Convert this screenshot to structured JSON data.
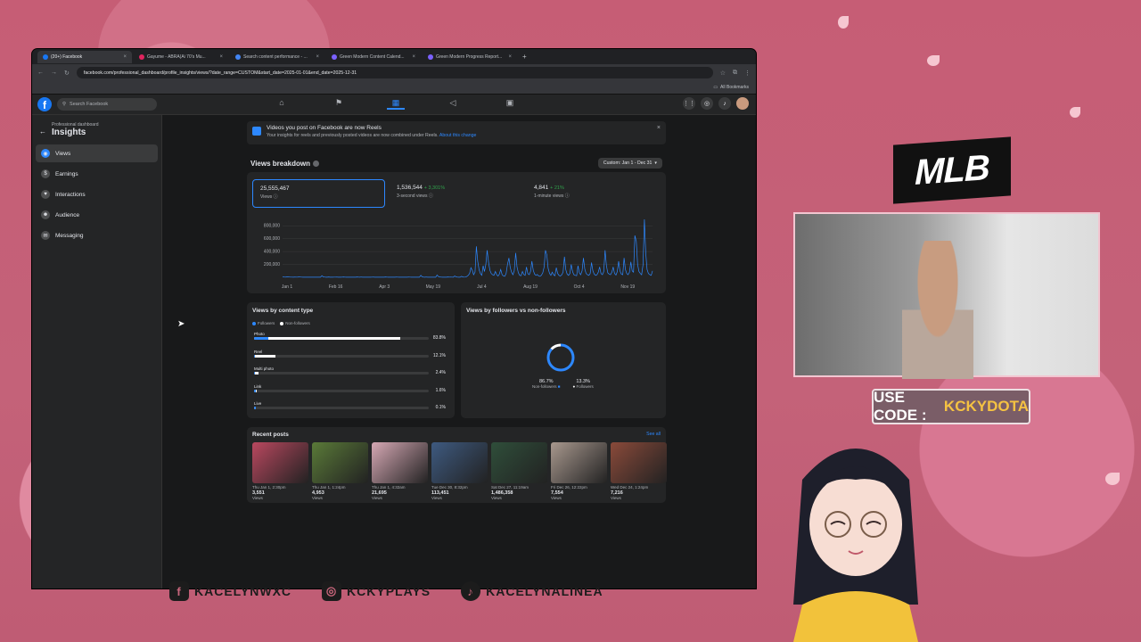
{
  "browser": {
    "tabs": [
      {
        "label": "(20+) Facebook",
        "active": true
      },
      {
        "label": "Gayume - ABRA(Ai 70's Mu...",
        "active": false
      },
      {
        "label": "Search content performance - ...",
        "active": false
      },
      {
        "label": "Green Modern Content Calend...",
        "active": false
      },
      {
        "label": "Green Modern Progress Report...",
        "active": false
      }
    ],
    "url": "facebook.com/professional_dashboard/profile_insights/views/?date_range=CUSTOM&start_date=2025-01-01&end_date=2025-12-31",
    "bookmarks_label": "All Bookmarks"
  },
  "fb": {
    "search_placeholder": "Search Facebook"
  },
  "sidebar": {
    "crumb": "Professional dashboard",
    "title": "Insights",
    "items": [
      {
        "label": "Views",
        "icon": "eye-icon"
      },
      {
        "label": "Earnings",
        "icon": "dollar-icon"
      },
      {
        "label": "Interactions",
        "icon": "heart-icon"
      },
      {
        "label": "Audience",
        "icon": "people-icon"
      },
      {
        "label": "Messaging",
        "icon": "chat-icon"
      }
    ]
  },
  "banner": {
    "title": "Videos you post on Facebook are now Reels",
    "text": "Your insights for reels and previously posted videos are now combined under Reels.",
    "link": "About this change"
  },
  "breakdown": {
    "title": "Views breakdown",
    "range": "Custom: Jan 1 - Dec 31",
    "metrics": [
      {
        "value": "25,555,467",
        "delta": "",
        "label": "Views"
      },
      {
        "value": "1,536,544",
        "delta": "+ 3,301%",
        "label": "3-second views"
      },
      {
        "value": "4,841",
        "delta": "+ 21%",
        "label": "1-minute views"
      }
    ]
  },
  "chart_data": [
    {
      "type": "line",
      "title": "Views breakdown",
      "x_ticks": [
        "Jan 1",
        "Feb 16",
        "Apr 3",
        "May 19",
        "Jul 4",
        "Aug 19",
        "Oct 4",
        "Nov 19"
      ],
      "y_ticks": [
        "200,000",
        "400,000",
        "600,000",
        "800,000"
      ],
      "ylim": [
        0,
        900000
      ],
      "series": [
        {
          "values": [
            5000,
            4000,
            3000,
            6000,
            5000,
            4000,
            3000,
            3000,
            2000,
            4000,
            3000,
            3000,
            5000,
            4000,
            3000,
            2000,
            2000,
            3000,
            2000,
            2000,
            3000,
            2000,
            2000,
            2000,
            3000,
            2000,
            3000,
            2000,
            2000,
            25000,
            8000,
            4000,
            2000,
            2000,
            6000,
            2000,
            2000,
            2000,
            3000,
            3000,
            4000,
            2000,
            2000,
            2000,
            3000,
            5000,
            3000,
            2000,
            2000,
            2000,
            3000,
            2000,
            2000,
            2000,
            2000,
            5000,
            3000,
            2000,
            4000,
            2000,
            2000,
            2000,
            3000,
            2000,
            2000,
            2000,
            3000,
            4000,
            2000,
            2000,
            2000,
            2000,
            2000,
            3000,
            2000,
            2000,
            5000,
            3000,
            2000,
            2000,
            3000,
            2000,
            2000,
            2000,
            4000,
            3000,
            2000,
            2000,
            2000,
            3000,
            2000,
            2000,
            2000,
            4000,
            3000,
            2000,
            2000,
            2000,
            3000,
            2000,
            2000,
            2000,
            30000,
            8000,
            3000,
            2000,
            4000,
            2000,
            2000,
            2000,
            3000,
            2000,
            2000,
            2000,
            35000,
            12000,
            5000,
            3000,
            2000,
            3000,
            2000,
            2000,
            5000,
            3000,
            4000,
            3000,
            2000,
            20000,
            8000,
            3000,
            2000,
            2000,
            15000,
            5000,
            3000,
            4000,
            12000,
            30000,
            60000,
            150000,
            110000,
            40000,
            80000,
            480000,
            250000,
            120000,
            60000,
            30000,
            180000,
            90000,
            200000,
            420000,
            230000,
            110000,
            60000,
            40000,
            30000,
            90000,
            40000,
            20000,
            50000,
            120000,
            40000,
            20000,
            15000,
            60000,
            200000,
            300000,
            150000,
            80000,
            40000,
            100000,
            380000,
            160000,
            70000,
            30000,
            25000,
            90000,
            45000,
            30000,
            160000,
            60000,
            40000,
            90000,
            250000,
            110000,
            50000,
            30000,
            45000,
            20000,
            15000,
            30000,
            70000,
            160000,
            420000,
            350000,
            140000,
            60000,
            30000,
            80000,
            40000,
            25000,
            150000,
            60000,
            30000,
            20000,
            40000,
            80000,
            320000,
            120000,
            50000,
            30000,
            60000,
            200000,
            90000,
            40000,
            30000,
            25000,
            180000,
            70000,
            40000,
            100000,
            300000,
            130000,
            60000,
            40000,
            30000,
            60000,
            230000,
            100000,
            50000,
            30000,
            40000,
            80000,
            160000,
            60000,
            40000,
            90000,
            420000,
            180000,
            70000,
            50000,
            40000,
            80000,
            160000,
            60000,
            35000,
            90000,
            250000,
            100000,
            50000,
            40000,
            300000,
            120000,
            60000,
            40000,
            80000,
            240000,
            100000,
            80000,
            650000,
            560000,
            200000,
            90000,
            60000,
            40000,
            200000,
            900000,
            380000,
            120000,
            60000,
            40000,
            30000,
            100000
          ]
        }
      ]
    },
    {
      "type": "bar",
      "title": "Views by content type",
      "legend": [
        "Followers",
        "Non-followers"
      ],
      "categories": [
        "Photo",
        "Reel",
        "Multi photo",
        "Link",
        "Live"
      ],
      "values": [
        83.8,
        12.1,
        2.4,
        1.6,
        0.1
      ],
      "labels": [
        "83.8%",
        "12.1%",
        "2.4%",
        "1.6%",
        "0.1%"
      ],
      "follower_share": [
        0.1,
        0.05,
        0.3,
        0.6,
        1.0
      ]
    },
    {
      "type": "pie",
      "title": "Views by followers vs non-followers",
      "categories": [
        "Non-followers",
        "Followers"
      ],
      "values": [
        86.7,
        13.3
      ],
      "labels": [
        "86.7%",
        "13.3%"
      ],
      "colors": [
        "#2d88ff",
        "#ffffff"
      ]
    }
  ],
  "recent": {
    "title": "Recent posts",
    "see_all": "See all",
    "views_label": "Views",
    "posts": [
      {
        "date": "Thu Jan 1, 2:30pm",
        "views": "3,551",
        "color": "#b9485f"
      },
      {
        "date": "Thu Jan 1, 1:24pm",
        "views": "4,953",
        "color": "#5a7a38"
      },
      {
        "date": "Thu Jan 1, 4:32am",
        "views": "21,695",
        "color": "#d6a8b4"
      },
      {
        "date": "Tue Dec 30, 8:32pm",
        "views": "113,451",
        "color": "#3e5a80"
      },
      {
        "date": "Sat Dec 27, 11:19am",
        "views": "1,486,358",
        "color": "#2f4e3a"
      },
      {
        "date": "Fri Dec 26, 12:22pm",
        "views": "7,554",
        "color": "#a8988e"
      },
      {
        "date": "Wed Dec 24, 1:24pm",
        "views": "7,216",
        "color": "#8a4a3a"
      }
    ]
  },
  "overlay": {
    "brand": "MLB",
    "code_prefix": "USE CODE :",
    "code_value": "KCKYDOTA",
    "socials": [
      "KACELYNWXC",
      "KCKYPLAYS",
      "KACELYNALINEA"
    ]
  }
}
